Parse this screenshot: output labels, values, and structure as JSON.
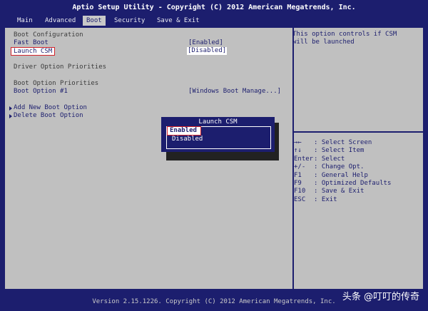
{
  "title": "Aptio Setup Utility - Copyright (C) 2012 American Megatrends, Inc.",
  "menu": [
    {
      "label": "Main",
      "active": false
    },
    {
      "label": "Advanced",
      "active": false
    },
    {
      "label": "Boot",
      "active": true
    },
    {
      "label": "Security",
      "active": false
    },
    {
      "label": "Save & Exit",
      "active": false
    }
  ],
  "boot": {
    "config_header": "Boot Configuration",
    "fast_boot_label": "Fast Boot",
    "fast_boot_value": "[Enabled]",
    "launch_csm_label": "Launch CSM",
    "launch_csm_value": "[Disabled]",
    "driver_priorities": "Driver Option Priorities",
    "boot_priorities": "Boot Option Priorities",
    "boot_option1_label": "Boot Option #1",
    "boot_option1_value": "[Windows Boot Manage...]",
    "add_option": "Add New Boot Option",
    "delete_option": "Delete Boot Option"
  },
  "help": {
    "text": "This option controls if CSM will be launched",
    "keys": [
      {
        "key": "→←",
        "desc": ": Select Screen"
      },
      {
        "key": "↑↓",
        "desc": ": Select Item"
      },
      {
        "key": "Enter",
        "desc": ": Select"
      },
      {
        "key": "+/-",
        "desc": ": Change Opt."
      },
      {
        "key": "F1",
        "desc": ": General Help"
      },
      {
        "key": "F9",
        "desc": ": Optimized Defaults"
      },
      {
        "key": "F10",
        "desc": ": Save & Exit"
      },
      {
        "key": "ESC",
        "desc": ": Exit"
      }
    ]
  },
  "popup": {
    "title": "Launch CSM",
    "option_enabled": "Enabled",
    "option_disabled": "Disabled"
  },
  "status": "Version 2.15.1226. Copyright (C) 2012 American Megatrends, Inc.",
  "watermark": "头条 @叮叮的传奇",
  "colors": {
    "background": "#1c1e6e",
    "panel": "#c0c0c0",
    "highlight_border": "#d2232a"
  }
}
